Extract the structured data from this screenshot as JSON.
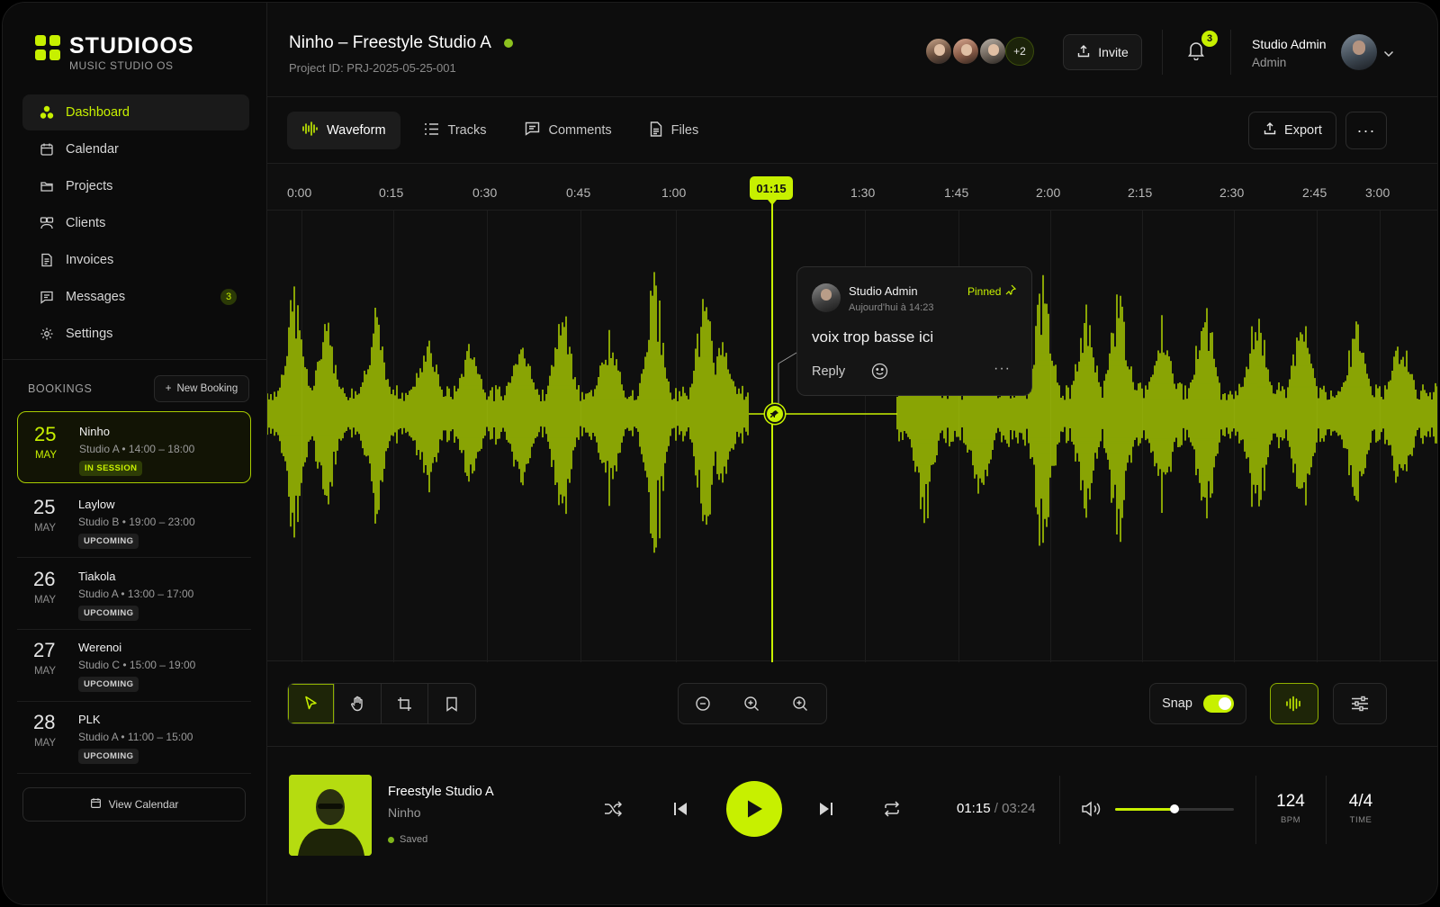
{
  "brand": {
    "name": "STUDIOOS",
    "subtitle": "MUSIC STUDIO OS",
    "accent": "#c7f000"
  },
  "nav": [
    {
      "label": "Dashboard",
      "icon": "dashboard-icon",
      "active": true
    },
    {
      "label": "Calendar",
      "icon": "calendar-icon"
    },
    {
      "label": "Projects",
      "icon": "folder-icon"
    },
    {
      "label": "Clients",
      "icon": "clients-icon"
    },
    {
      "label": "Invoices",
      "icon": "invoice-icon"
    },
    {
      "label": "Messages",
      "icon": "message-icon",
      "badge": "3"
    },
    {
      "label": "Settings",
      "icon": "gear-icon"
    }
  ],
  "bookings": {
    "heading": "BOOKINGS",
    "new_label": "New Booking",
    "items": [
      {
        "day": "25",
        "month": "MAY",
        "name": "Ninho",
        "studio": "Studio A",
        "time": "14:00 – 18:00",
        "status": "IN SESSION",
        "active": true
      },
      {
        "day": "25",
        "month": "MAY",
        "name": "Laylow",
        "studio": "Studio B",
        "time": "19:00 – 23:00",
        "status": "UPCOMING"
      },
      {
        "day": "26",
        "month": "MAY",
        "name": "Tiakola",
        "studio": "Studio A",
        "time": "13:00 – 17:00",
        "status": "UPCOMING"
      },
      {
        "day": "27",
        "month": "MAY",
        "name": "Werenoi",
        "studio": "Studio C",
        "time": "15:00 – 19:00",
        "status": "UPCOMING"
      },
      {
        "day": "28",
        "month": "MAY",
        "name": "PLK",
        "studio": "Studio A",
        "time": "11:00 – 15:00",
        "status": "UPCOMING"
      }
    ],
    "view_calendar": "View Calendar"
  },
  "header": {
    "title": "Ninho – Freestyle Studio A",
    "project_id": "Project ID: PRJ-2025-05-25-001",
    "collaborators_more": "+2",
    "invite": "Invite",
    "notifications": "3",
    "user_name": "Studio Admin",
    "user_role": "Admin"
  },
  "tabs": [
    {
      "label": "Waveform",
      "icon": "waveform-icon",
      "active": true
    },
    {
      "label": "Tracks",
      "icon": "list-icon"
    },
    {
      "label": "Comments",
      "icon": "comment-icon"
    },
    {
      "label": "Files",
      "icon": "file-icon"
    }
  ],
  "actions": {
    "export": "Export",
    "more": "···"
  },
  "timeline": {
    "ticks": [
      "0:00",
      "0:15",
      "0:30",
      "0:45",
      "1:00",
      "1:30",
      "1:45",
      "2:00",
      "2:15",
      "2:30",
      "2:45",
      "3:00"
    ],
    "playhead": "01:15"
  },
  "comment": {
    "author": "Studio Admin",
    "time": "Aujourd'hui à 14:23",
    "pinned": "Pinned",
    "text": "voix trop basse ici",
    "reply": "Reply",
    "more": "···"
  },
  "toolbar": {
    "snap": "Snap",
    "snap_on": true
  },
  "player": {
    "title": "Freestyle Studio A",
    "artist": "Ninho",
    "saved": "Saved",
    "current": "01:15",
    "sep": " / ",
    "total": "03:24",
    "volume": 0.5,
    "bpm": "124",
    "bpm_label": "BPM",
    "signature": "4/4",
    "signature_label": "TIME"
  }
}
